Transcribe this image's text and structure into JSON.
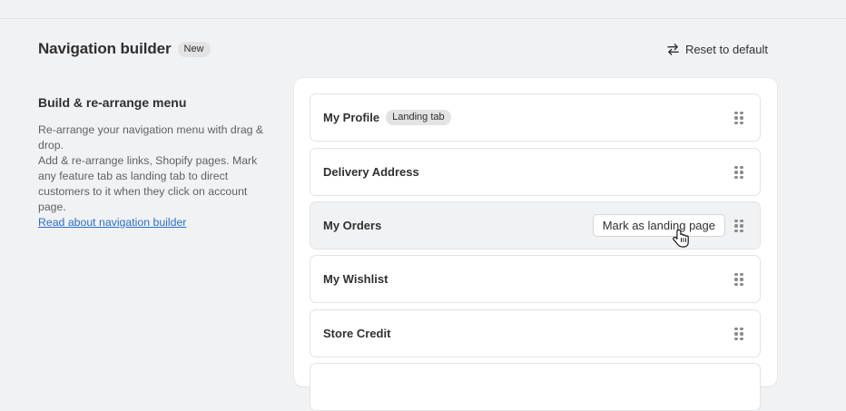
{
  "header": {
    "title": "Navigation builder",
    "badge": "New",
    "reset_label": "Reset to default"
  },
  "info": {
    "section_title": "Build & re-arrange menu",
    "description_1": "Re-arrange your navigation menu with drag & drop.",
    "description_2": "Add & re-arrange links, Shopify pages. Mark any feature tab as landing tab to direct customers to it when they click on account page.",
    "link": "Read about navigation builder"
  },
  "menu": {
    "items": [
      {
        "label": "My Profile",
        "badge": "Landing tab"
      },
      {
        "label": "Delivery Address"
      },
      {
        "label": "My Orders",
        "action": "Mark as landing page"
      },
      {
        "label": "My Wishlist"
      },
      {
        "label": "Store Credit"
      }
    ]
  },
  "icons": {
    "reset": "swap-arrows-icon",
    "drag": "drag-handle-icon",
    "cursor": "hand-pointer-icon"
  },
  "colors": {
    "background": "#f1f2f4",
    "card": "#ffffff",
    "link": "#2c6ecb",
    "badge": "#e3e3e3",
    "hover_row": "#f1f2f4"
  }
}
